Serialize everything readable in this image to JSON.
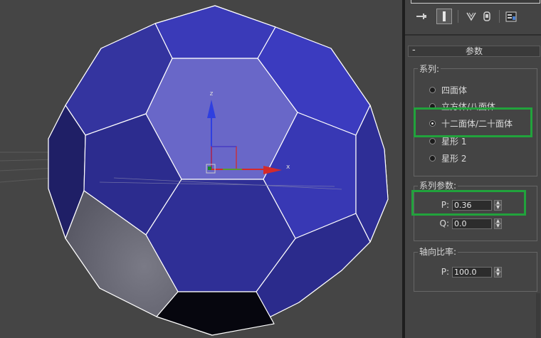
{
  "panel": {
    "rollout_title": "参数",
    "family_group": {
      "label": "系列:",
      "options": [
        "四面体",
        "立方体/八面体",
        "十二面体/二十面体",
        "星形 1",
        "星形 2"
      ],
      "selected_index": 2
    },
    "family_params": {
      "label": "系列参数:",
      "p_label": "P:",
      "p_value": "0.36",
      "q_label": "Q:",
      "q_value": "0.0"
    },
    "axis_ratio": {
      "label": "轴向比率:",
      "p_label": "P:",
      "p_value": "100.0"
    }
  },
  "viewport": {
    "gizmo": {
      "z_label": "z",
      "x_label": "x"
    },
    "colors": {
      "face": "#3b3bb5",
      "face_light": "#6a67c9",
      "face_dark": "#1e1e66",
      "face_grey": "#6a6a78",
      "face_black": "#070710",
      "edge": "#ffffff"
    }
  },
  "highlight_color": "#21a33c"
}
